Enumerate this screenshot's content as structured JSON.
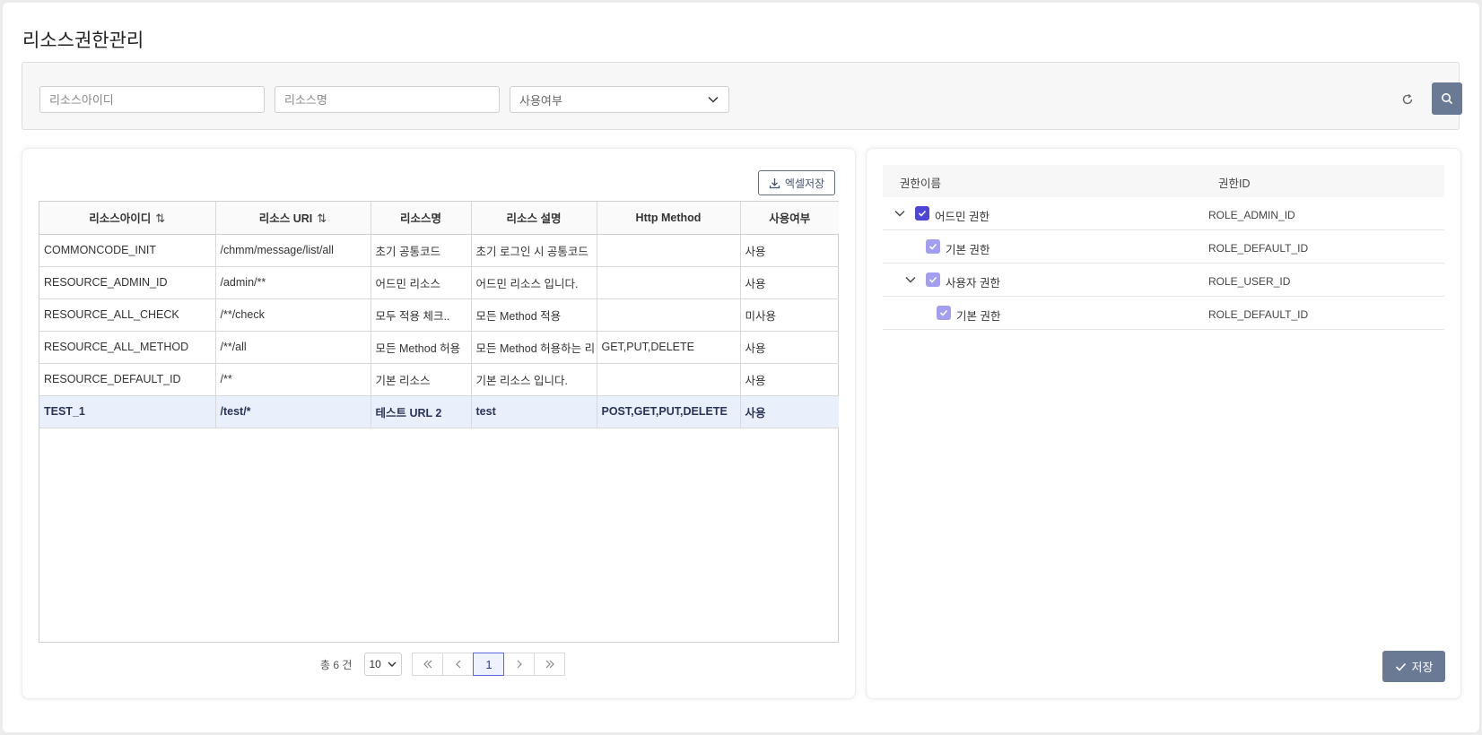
{
  "page": {
    "title": "리소스권한관리"
  },
  "search": {
    "resource_id_placeholder": "리소스아이디",
    "resource_name_placeholder": "리소스명",
    "use_select_value": "사용여부"
  },
  "toolbar": {
    "excel_label": "엑셀저장"
  },
  "grid": {
    "columns": [
      {
        "label": "리소스아이디",
        "sortable": true
      },
      {
        "label": "리소스 URI",
        "sortable": true
      },
      {
        "label": "리소스명",
        "sortable": false
      },
      {
        "label": "리소스 설명",
        "sortable": false
      },
      {
        "label": "Http Method",
        "sortable": false
      },
      {
        "label": "사용여부",
        "sortable": false
      }
    ],
    "rows": [
      [
        "COMMONCODE_INIT",
        "/chmm/message/list/all",
        "초기 공통코드",
        "초기 로그인 시 공통코드",
        "",
        "사용"
      ],
      [
        "RESOURCE_ADMIN_ID",
        "/admin/**",
        "어드민 리소스",
        "어드민 리소스 입니다.",
        "",
        "사용"
      ],
      [
        "RESOURCE_ALL_CHECK",
        "/**/check",
        "모두 적용 체크..",
        "모든 Method 적용",
        "",
        "미사용"
      ],
      [
        "RESOURCE_ALL_METHOD",
        "/**/all",
        "모든 Method 허용",
        "모든 Method 허용하는 리",
        "GET,PUT,DELETE",
        "사용"
      ],
      [
        "RESOURCE_DEFAULT_ID",
        "/**",
        "기본 리소스",
        "기본 리소스 입니다.",
        "",
        "사용"
      ],
      [
        "TEST_1",
        "/test/*",
        "테스트 URL 2",
        "test",
        "POST,GET,PUT,DELETE",
        "사용"
      ]
    ],
    "selected_row": 5
  },
  "pager": {
    "total_label": "총 6 건",
    "page_size": "10",
    "current_page": "1"
  },
  "tree": {
    "header_name": "권한이름",
    "header_id": "권한ID",
    "nodes": [
      {
        "name": "어드민 권한",
        "id": "ROLE_ADMIN_ID",
        "depth": 0,
        "expandable": true,
        "check": "full"
      },
      {
        "name": "기본 권한",
        "id": "ROLE_DEFAULT_ID",
        "depth": 1,
        "expandable": false,
        "check": "partial"
      },
      {
        "name": "사용자 권한",
        "id": "ROLE_USER_ID",
        "depth": 1,
        "expandable": true,
        "check": "partial"
      },
      {
        "name": "기본 권한",
        "id": "ROLE_DEFAULT_ID",
        "depth": 2,
        "expandable": false,
        "check": "partial"
      }
    ]
  },
  "actions": {
    "save_label": "저장"
  },
  "icons": {
    "reset": "refresh-icon",
    "search": "search-icon",
    "excel": "download-icon",
    "save": "check-icon",
    "expand": "chevron-down-icon",
    "sort": "sort-icon"
  },
  "colors": {
    "primary_button": "#6b7a94",
    "checkbox_full": "#4c45d6",
    "checkbox_partial": "#a39ff0",
    "selected_row": "#eaf0fb",
    "active_page": "#5a67d8"
  }
}
